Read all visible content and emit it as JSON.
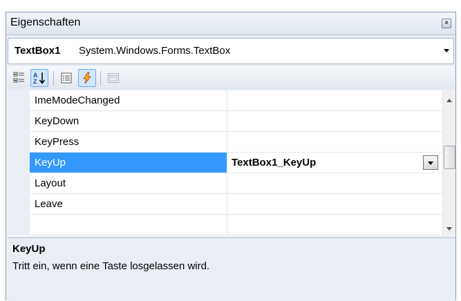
{
  "window": {
    "title": "Eigenschaften",
    "close_glyph": "×"
  },
  "object_selector": {
    "name": "TextBox1",
    "type": "System.Windows.Forms.TextBox"
  },
  "toolbar": {
    "buttons": [
      {
        "icon": "categorized-icon",
        "active": false
      },
      {
        "icon": "alphabetical-icon",
        "active": true
      },
      {
        "icon": "properties-icon",
        "active": false
      },
      {
        "icon": "events-icon",
        "active": true
      },
      {
        "icon": "property-pages-icon",
        "active": false
      }
    ]
  },
  "grid": {
    "rows": [
      {
        "name": "ImeModeChanged",
        "value": ""
      },
      {
        "name": "KeyDown",
        "value": ""
      },
      {
        "name": "KeyPress",
        "value": ""
      },
      {
        "name": "KeyUp",
        "value": "TextBox1_KeyUp",
        "selected": true
      },
      {
        "name": "Layout",
        "value": ""
      },
      {
        "name": "Leave",
        "value": ""
      },
      {
        "name": "",
        "value": ""
      }
    ]
  },
  "description": {
    "title": "KeyUp",
    "text": "Tritt ein, wenn eine Taste losgelassen wird."
  },
  "colors": {
    "selection": "#3399ff",
    "panel": "#e9eef5",
    "active_button": "#cfe6fc"
  }
}
